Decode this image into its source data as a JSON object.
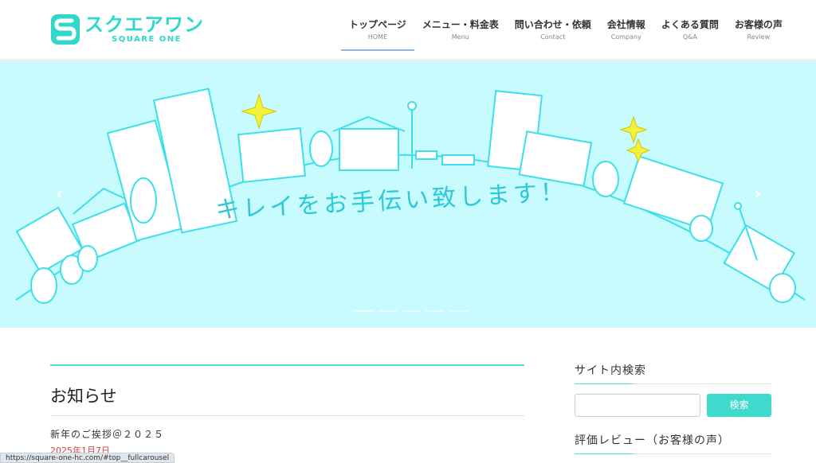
{
  "logo": {
    "text": "スクエアワン",
    "sub": "SQUARE ONE",
    "mark_color": "#2fd8c8"
  },
  "nav": [
    {
      "ja": "トップページ",
      "en": "HOME",
      "active": true
    },
    {
      "ja": "メニュー・料金表",
      "en": "Menu"
    },
    {
      "ja": "問い合わせ・依頼",
      "en": "Contact"
    },
    {
      "ja": "会社情報",
      "en": "Company"
    },
    {
      "ja": "よくある質問",
      "en": "Q&A"
    },
    {
      "ja": "お客様の声",
      "en": "Review"
    }
  ],
  "hero": {
    "caption": "キレイをお手伝い致します！",
    "prev_arrow": "‹",
    "next_arrow": "›",
    "slides_count": 5,
    "active_slide": 1,
    "background": "#c8fbfd",
    "line_color": "#3be0ea"
  },
  "main": {
    "section_title": "お知らせ",
    "posts": [
      {
        "title": "新年のご挨拶＠２０２５",
        "date": "2025年1月7日"
      }
    ]
  },
  "sidebar": {
    "search_title": "サイト内検索",
    "search_placeholder": "",
    "search_button": "検索",
    "reviews_title": "評価レビュー（お客様の声）"
  },
  "status_url": "https://square-one-hc.com/#top__fullcarousel"
}
